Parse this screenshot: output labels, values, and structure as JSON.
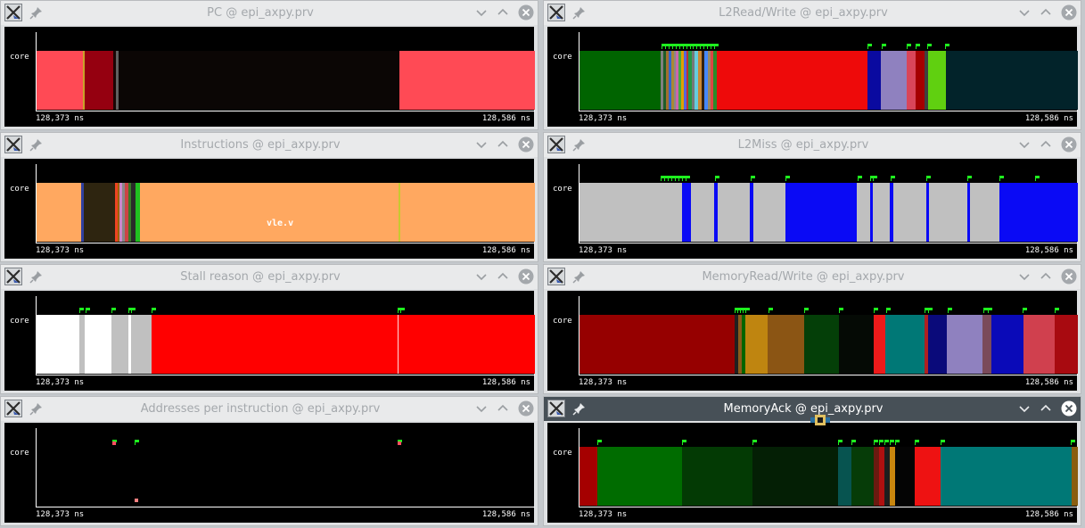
{
  "common": {
    "row_label": "core",
    "time_start": "128,373 ns",
    "time_end": "128,586 ns"
  },
  "colors": {
    "flag_marker": "#1ef01e",
    "active_titlebar": "#475057",
    "inactive_title_text": "#a4a8ac"
  },
  "windows": [
    {
      "title": "PC @ epi_axpy.prv",
      "active": false,
      "segments": [
        {
          "s": 0,
          "e": 9.3,
          "c": "#ff4a55"
        },
        {
          "s": 9.3,
          "e": 9.6,
          "c": "#c8a428"
        },
        {
          "s": 9.6,
          "e": 15.3,
          "c": "#950010"
        },
        {
          "s": 15.3,
          "e": 16.0,
          "c": "#1a0605"
        },
        {
          "s": 16.0,
          "e": 16.4,
          "c": "#606060"
        },
        {
          "s": 16.4,
          "e": 17.1,
          "c": "#0b0605"
        },
        {
          "s": 17.1,
          "e": 72.8,
          "c": "#0b0605"
        },
        {
          "s": 72.8,
          "e": 100,
          "c": "#ff4a55"
        }
      ],
      "flags": [],
      "points": []
    },
    {
      "title": "L2Read/Write @ epi_axpy.prv",
      "active": false,
      "segments": [
        {
          "s": 0,
          "e": 16.2,
          "c": "#006400"
        },
        {
          "s": 16.2,
          "e": 16.8,
          "c": "#808080"
        },
        {
          "s": 16.8,
          "e": 17.3,
          "c": "#1e5c28"
        },
        {
          "s": 17.3,
          "e": 17.9,
          "c": "#a07030"
        },
        {
          "s": 17.9,
          "e": 18.4,
          "c": "#3366cc"
        },
        {
          "s": 18.4,
          "e": 18.9,
          "c": "#aa8833"
        },
        {
          "s": 18.9,
          "e": 19.4,
          "c": "#888888"
        },
        {
          "s": 19.4,
          "e": 19.9,
          "c": "#cc66aa"
        },
        {
          "s": 19.9,
          "e": 20.4,
          "c": "#44aa44"
        },
        {
          "s": 20.4,
          "e": 20.9,
          "c": "#e0a000"
        },
        {
          "s": 20.9,
          "e": 21.4,
          "c": "#5566dd"
        },
        {
          "s": 21.4,
          "e": 21.9,
          "c": "#bb3333"
        },
        {
          "s": 21.9,
          "e": 22.5,
          "c": "#229944"
        },
        {
          "s": 22.5,
          "e": 23.1,
          "c": "#777777"
        },
        {
          "s": 23.1,
          "e": 23.8,
          "c": "#66ccdd"
        },
        {
          "s": 23.8,
          "e": 24.5,
          "c": "#cc8833"
        },
        {
          "s": 24.5,
          "e": 25.1,
          "c": "#332211"
        },
        {
          "s": 25.1,
          "e": 25.7,
          "c": "#4488ff"
        },
        {
          "s": 25.7,
          "e": 26.3,
          "c": "#998866"
        },
        {
          "s": 26.3,
          "e": 26.9,
          "c": "#dd4444"
        },
        {
          "s": 26.9,
          "e": 27.6,
          "c": "#2a8a2a"
        },
        {
          "s": 27.6,
          "e": 57.8,
          "c": "#ee0a0a"
        },
        {
          "s": 57.8,
          "e": 60.5,
          "c": "#0a0aa0"
        },
        {
          "s": 60.5,
          "e": 65.7,
          "c": "#8f81bf"
        },
        {
          "s": 65.7,
          "e": 67.4,
          "c": "#d9465a"
        },
        {
          "s": 67.4,
          "e": 69.2,
          "c": "#a50000"
        },
        {
          "s": 69.2,
          "e": 69.9,
          "c": "#404040"
        },
        {
          "s": 69.9,
          "e": 73.6,
          "c": "#60d010"
        },
        {
          "s": 73.6,
          "e": 100,
          "c": "#02232a"
        }
      ],
      "flags": [
        16.5,
        17.2,
        17.9,
        18.6,
        19.3,
        20.0,
        20.7,
        21.4,
        22.1,
        22.8,
        23.5,
        24.2,
        24.9,
        25.6,
        26.3,
        27.0,
        57.8,
        60.6,
        65.7,
        67.5,
        69.7,
        73.4
      ],
      "points": []
    },
    {
      "title": "Instructions @ epi_axpy.prv",
      "active": false,
      "segments": [
        {
          "s": 0,
          "e": 8.9,
          "c": "#ffa860"
        },
        {
          "s": 8.9,
          "e": 9.4,
          "c": "#3040a0"
        },
        {
          "s": 9.4,
          "e": 15.7,
          "c": "#2e2510"
        },
        {
          "s": 15.7,
          "e": 16.2,
          "c": "#ee4422"
        },
        {
          "s": 16.2,
          "e": 16.7,
          "c": "#996600"
        },
        {
          "s": 16.7,
          "e": 17.2,
          "c": "#cc88cc"
        },
        {
          "s": 17.2,
          "e": 17.7,
          "c": "#888888"
        },
        {
          "s": 17.7,
          "e": 18.4,
          "c": "#cc4444"
        },
        {
          "s": 18.4,
          "e": 19.0,
          "c": "#3a7a2a"
        },
        {
          "s": 19.0,
          "e": 19.8,
          "c": "#2a2a2a"
        },
        {
          "s": 19.8,
          "e": 20.8,
          "c": "#20c020"
        },
        {
          "s": 20.8,
          "e": 72.6,
          "c": "#ffa860"
        },
        {
          "s": 72.6,
          "e": 73.0,
          "c": "#c8c830"
        },
        {
          "s": 73.0,
          "e": 100,
          "c": "#ffa860"
        }
      ],
      "flags": [],
      "points": [],
      "tooltip": {
        "label": "vle.v",
        "color": "#ffa860"
      }
    },
    {
      "title": "L2Miss @ epi_axpy.prv",
      "active": false,
      "segments": [
        {
          "s": 0,
          "e": 20.5,
          "c": "#c0c0c0"
        },
        {
          "s": 20.5,
          "e": 22.4,
          "c": "#0a0af5"
        },
        {
          "s": 22.4,
          "e": 27.1,
          "c": "#c0c0c0"
        },
        {
          "s": 27.1,
          "e": 27.7,
          "c": "#0a0af5"
        },
        {
          "s": 27.7,
          "e": 34.2,
          "c": "#c0c0c0"
        },
        {
          "s": 34.2,
          "e": 34.8,
          "c": "#0a0af5"
        },
        {
          "s": 34.8,
          "e": 41.3,
          "c": "#c0c0c0"
        },
        {
          "s": 41.3,
          "e": 55.7,
          "c": "#0a0af5"
        },
        {
          "s": 55.7,
          "e": 58.3,
          "c": "#c0c0c0"
        },
        {
          "s": 58.3,
          "e": 58.9,
          "c": "#0a0af5"
        },
        {
          "s": 58.9,
          "e": 62.3,
          "c": "#c0c0c0"
        },
        {
          "s": 62.3,
          "e": 62.9,
          "c": "#0a0af5"
        },
        {
          "s": 62.9,
          "e": 69.5,
          "c": "#c0c0c0"
        },
        {
          "s": 69.5,
          "e": 70.1,
          "c": "#0a0af5"
        },
        {
          "s": 70.1,
          "e": 77.8,
          "c": "#c0c0c0"
        },
        {
          "s": 77.8,
          "e": 78.4,
          "c": "#0a0af5"
        },
        {
          "s": 78.4,
          "e": 84.3,
          "c": "#c0c0c0"
        },
        {
          "s": 84.3,
          "e": 100,
          "c": "#0a0af5"
        }
      ],
      "flags": [
        16.3,
        17.0,
        17.7,
        18.4,
        19.1,
        19.8,
        20.5,
        21.2,
        27.2,
        34.3,
        41.4,
        55.8,
        58.4,
        58.9,
        62.4,
        69.5,
        77.9,
        84.3,
        91.4
      ],
      "points": []
    },
    {
      "title": "Stall reason @ epi_axpy.prv",
      "active": false,
      "segments": [
        {
          "s": 0,
          "e": 8.6,
          "c": "#ffffff"
        },
        {
          "s": 8.6,
          "e": 9.6,
          "c": "#c0c0c0"
        },
        {
          "s": 9.6,
          "e": 15.1,
          "c": "#ffffff"
        },
        {
          "s": 15.1,
          "e": 18.4,
          "c": "#c0c0c0"
        },
        {
          "s": 18.4,
          "e": 18.9,
          "c": "#ffffff"
        },
        {
          "s": 18.9,
          "e": 23.1,
          "c": "#c0c0c0"
        },
        {
          "s": 23.1,
          "e": 72.4,
          "c": "#ff0000"
        },
        {
          "s": 72.4,
          "e": 72.7,
          "c": "#ffdddd"
        },
        {
          "s": 72.7,
          "e": 100,
          "c": "#ff0000"
        }
      ],
      "flags": [
        8.6,
        9.8,
        15.1,
        18.4,
        18.9,
        23.1,
        72.4,
        72.9
      ],
      "points": []
    },
    {
      "title": "MemoryRead/Write @ epi_axpy.prv",
      "active": false,
      "segments": [
        {
          "s": 0,
          "e": 31.1,
          "c": "#960000"
        },
        {
          "s": 31.1,
          "e": 31.8,
          "c": "#202020"
        },
        {
          "s": 31.8,
          "e": 32.5,
          "c": "#8a5a1a"
        },
        {
          "s": 32.5,
          "e": 33.2,
          "c": "#006400"
        },
        {
          "s": 33.2,
          "e": 37.8,
          "c": "#bf8510"
        },
        {
          "s": 37.8,
          "e": 45.0,
          "c": "#8b5514"
        },
        {
          "s": 45.0,
          "e": 52.0,
          "c": "#043f08"
        },
        {
          "s": 52.0,
          "e": 59.0,
          "c": "#050a05"
        },
        {
          "s": 59.0,
          "e": 61.4,
          "c": "#ee1a1a"
        },
        {
          "s": 61.4,
          "e": 69.2,
          "c": "#007876"
        },
        {
          "s": 69.2,
          "e": 69.9,
          "c": "#b02020"
        },
        {
          "s": 69.9,
          "e": 73.7,
          "c": "#0a0a7a"
        },
        {
          "s": 73.7,
          "e": 80.9,
          "c": "#8f81bf"
        },
        {
          "s": 80.9,
          "e": 82.6,
          "c": "#7a4a5a"
        },
        {
          "s": 82.6,
          "e": 89.1,
          "c": "#0a0ab8"
        },
        {
          "s": 89.1,
          "e": 95.3,
          "c": "#d0404e"
        },
        {
          "s": 95.3,
          "e": 100,
          "c": "#a80a10"
        }
      ],
      "flags": [
        31.2,
        31.7,
        32.2,
        32.7,
        33.2,
        38.0,
        45.1,
        52.1,
        59.1,
        61.5,
        69.2,
        69.9,
        73.8,
        81.0,
        82.0,
        88.9,
        95.3
      ],
      "points": []
    },
    {
      "title": "Addresses per instruction @ epi_axpy.prv",
      "active": false,
      "segments": [],
      "flags": [
        15.2,
        19.6,
        72.4
      ],
      "points": [
        {
          "x": 15.2,
          "row": "top",
          "c": "#ff5060"
        },
        {
          "x": 19.6,
          "row": "bottom",
          "c": "#ff8080"
        },
        {
          "x": 72.4,
          "row": "top",
          "c": "#ff5060"
        }
      ]
    },
    {
      "title": "MemoryAck @ epi_axpy.prv",
      "active": true,
      "segments": [
        {
          "s": 0,
          "e": 3.6,
          "c": "#a50000"
        },
        {
          "s": 3.6,
          "e": 20.6,
          "c": "#006c00"
        },
        {
          "s": 20.6,
          "e": 34.7,
          "c": "#033a04"
        },
        {
          "s": 34.7,
          "e": 51.9,
          "c": "#041f05"
        },
        {
          "s": 51.9,
          "e": 54.6,
          "c": "#075450"
        },
        {
          "s": 54.6,
          "e": 59.1,
          "c": "#063c08"
        },
        {
          "s": 59.1,
          "e": 60.1,
          "c": "#6a1a10"
        },
        {
          "s": 60.1,
          "e": 61.1,
          "c": "#b01010"
        },
        {
          "s": 61.1,
          "e": 62.2,
          "c": "#1e1e1e"
        },
        {
          "s": 62.2,
          "e": 63.3,
          "c": "#c8860e"
        },
        {
          "s": 63.3,
          "e": 67.3,
          "c": "#040404"
        },
        {
          "s": 67.3,
          "e": 72.4,
          "c": "#ee1212"
        },
        {
          "s": 72.4,
          "e": 98.7,
          "c": "#007876"
        },
        {
          "s": 98.7,
          "e": 100,
          "c": "#8a5e10"
        }
      ],
      "flags": [
        3.6,
        20.6,
        34.7,
        51.9,
        54.6,
        59.1,
        60.1,
        61.1,
        62.2,
        63.3,
        67.3,
        72.4,
        98.6
      ],
      "points": []
    }
  ]
}
